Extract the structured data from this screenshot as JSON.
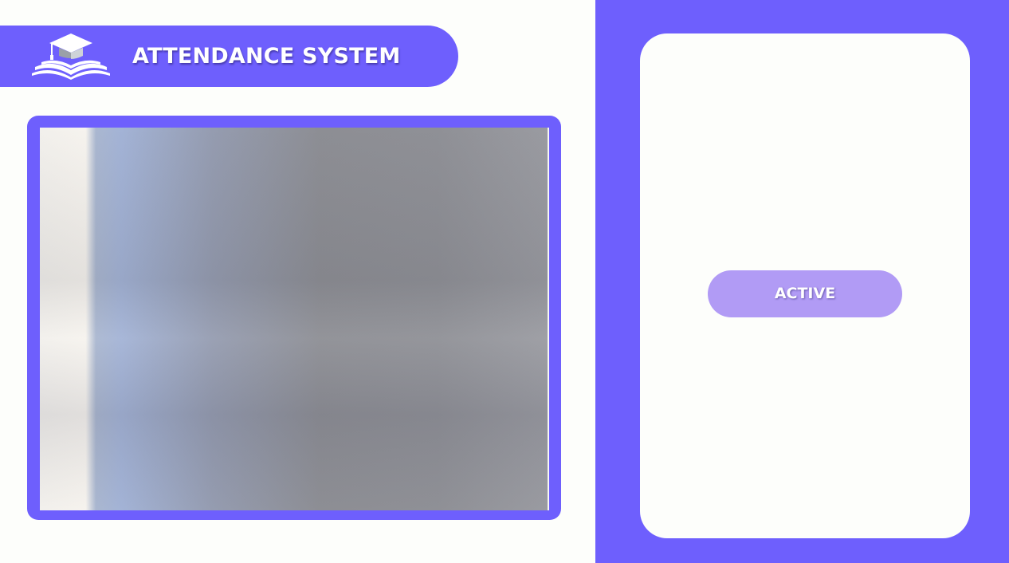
{
  "header": {
    "title": "ATTENDANCE SYSTEM",
    "logo_icon": "graduation-cap-book-icon"
  },
  "camera": {
    "feed_icon": "camera-feed"
  },
  "status_panel": {
    "button_label": "ACTIVE"
  },
  "colors": {
    "accent": "#6e5ffd",
    "background": "#fdfefb",
    "status_button": "#b19bf5",
    "text_light": "#ffffff"
  }
}
